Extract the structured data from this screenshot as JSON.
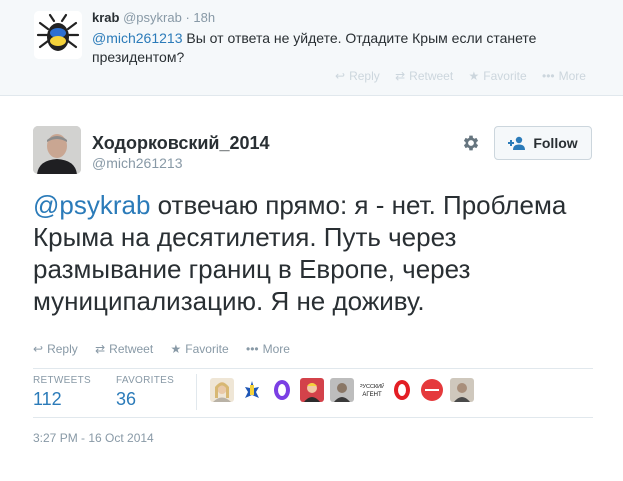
{
  "parent_tweet": {
    "fullname": "krab",
    "screen_name": "@psykrab",
    "separator": "·",
    "time": "18h",
    "mention": "@mich261213",
    "text": " Вы от ответа не уйдете. Отдадите Крым если станете президентом?",
    "actions": {
      "reply": "Reply",
      "retweet": "Retweet",
      "favorite": "Favorite",
      "more": "More"
    }
  },
  "main_tweet": {
    "fullname": "Ходорковский_2014",
    "screen_name": "@mich261213",
    "follow_label": "Follow",
    "mention": "@psykrab",
    "text": " отвечаю прямо: я - нет. Проблема Крыма на десятилетия. Путь через размывание границ в Европе, через муниципализацию.  Я не доживу.",
    "actions": {
      "reply": "Reply",
      "retweet": "Retweet",
      "favorite": "Favorite",
      "more": "More"
    },
    "stats": {
      "retweets_label": "RETWEETS",
      "retweets_value": "112",
      "favorites_label": "FAVORITES",
      "favorites_value": "36"
    },
    "favoriter_avatar_colors": [
      "#e8d9b8",
      "#f4d23c",
      "#7b3fe4",
      "#d3424a",
      "#3a3a3a",
      "#1a1a1a",
      "#e31e24",
      "#e5393c",
      "#8a7a6a"
    ],
    "favoriter_badge_text": "РУССКИЙ АГЕНТ",
    "timestamp": "3:27 PM - 16 Oct 2014"
  },
  "colors": {
    "link": "#2b7bb9",
    "muted": "#8899a6",
    "text": "#292f33"
  }
}
